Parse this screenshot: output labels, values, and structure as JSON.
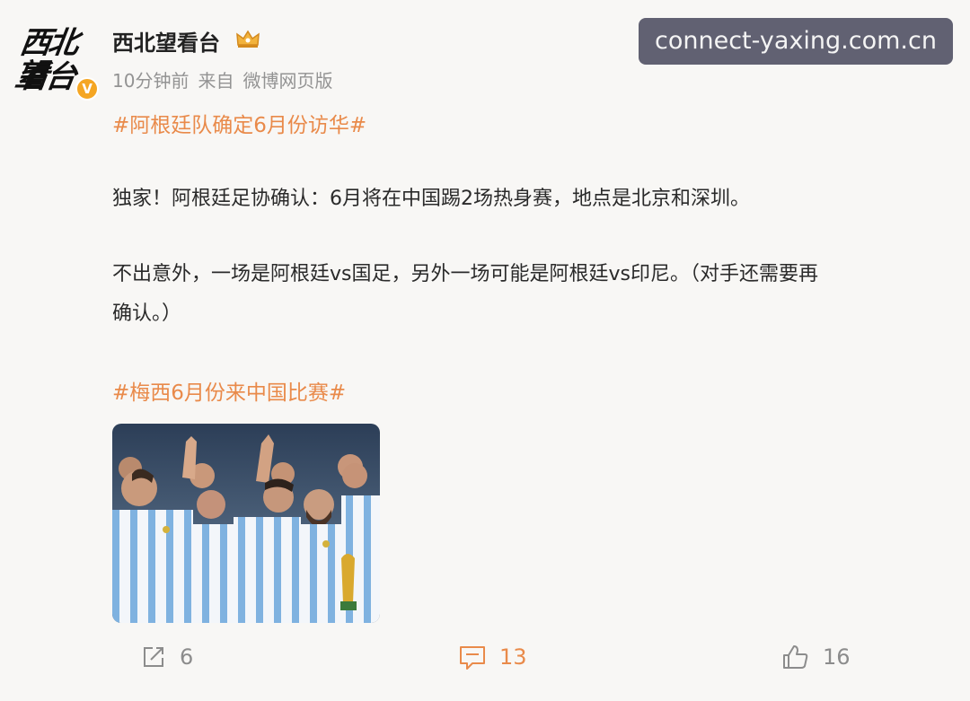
{
  "post": {
    "avatar_text_line1": "西北望",
    "avatar_text_line2": "看台",
    "verified_badge": "V",
    "username": "西北望看台",
    "crown_icon": "crown-icon",
    "time": "10分钟前",
    "source_prefix": "来自",
    "source": "微博网页版",
    "hashtag1": "#阿根廷队确定6月份访华#",
    "para1": "独家！阿根廷足协确认：6月将在中国踢2场热身赛，地点是北京和深圳。",
    "para2_line1": "不出意外，一场是阿根廷vs国足，另外一场可能是阿根廷vs印尼。（对手还需要再",
    "para2_line2": "确认。）",
    "hashtag2": "#梅西6月份来中国比赛#",
    "image_alt": "argentina-team-photo"
  },
  "watermark": "connect-yaxing.com.cn",
  "actions": {
    "share_count": "6",
    "comment_count": "13",
    "like_count": "16"
  },
  "colors": {
    "accent": "#e98a4a",
    "meta": "#939393",
    "background": "#f8f7f5"
  }
}
